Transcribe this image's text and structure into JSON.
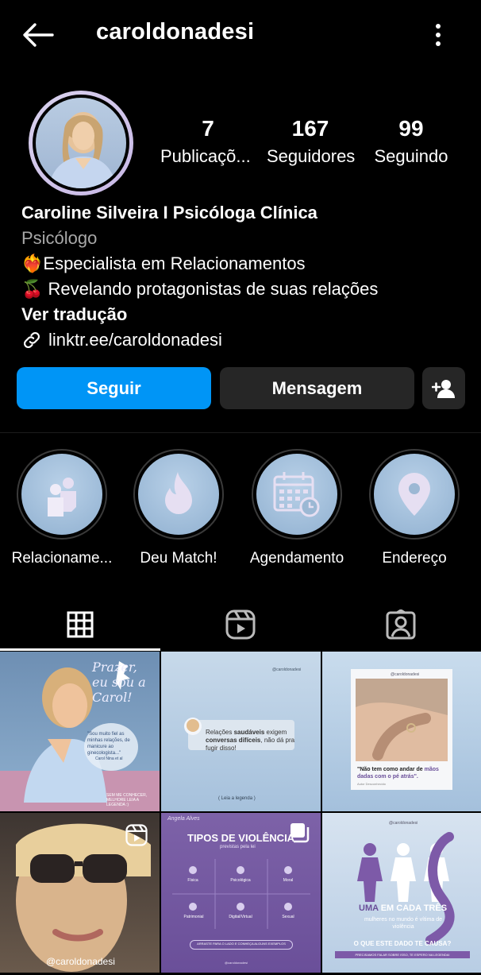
{
  "header": {
    "username": "caroldonadesi",
    "back_icon": "arrow-left-icon",
    "menu_icon": "more-vertical-icon"
  },
  "stats": [
    {
      "value": "7",
      "label": "Publicaçõ..."
    },
    {
      "value": "167",
      "label": "Seguidores"
    },
    {
      "value": "99",
      "label": "Seguindo"
    }
  ],
  "bio": {
    "name": "Caroline Silveira I Psicóloga Clínica",
    "category": "Psicólogo",
    "line1": "❤️‍🔥Especialista em Relacionamentos",
    "line2": "🍒 Revelando protagonistas de suas relações",
    "translate": "Ver tradução",
    "link": "linktr.ee/caroldonadesi"
  },
  "buttons": {
    "follow": "Seguir",
    "message": "Mensagem"
  },
  "highlights": [
    {
      "label": "Relacioname...",
      "icon": "people-icon"
    },
    {
      "label": "Deu Match!",
      "icon": "flame-icon"
    },
    {
      "label": "Agendamento",
      "icon": "calendar-icon"
    },
    {
      "label": "Endereço",
      "icon": "location-pin-icon"
    }
  ],
  "tabs": [
    {
      "name": "grid",
      "icon": "grid-icon",
      "active": true
    },
    {
      "name": "reels",
      "icon": "reels-icon",
      "active": false
    },
    {
      "name": "tagged",
      "icon": "tagged-icon",
      "active": false
    }
  ],
  "posts": {
    "p1": {
      "title": "Prazer, eu sou a Carol!",
      "quote": "\"Sou muito fiel as minhas relações, de manicure ao ginecologista...\"",
      "author": "Carol Nina et al",
      "cta": "SEM ME CONHECER, MELHORE LEIA A LEGENDA :)"
    },
    "p2": {
      "text_a": "Relações ",
      "text_b": "saudáveis",
      "text_c": " exigem ",
      "text_d": "conversas difíceis",
      "text_e": ", não dá pra fugir disso!",
      "handle": "@caroldonadesi",
      "cta": "( Leia a legenda )"
    },
    "p3": {
      "handle": "@caroldonadesi",
      "quote_a": "\"Não tem como andar de ",
      "quote_b": "mãos dadas com o pé atrás\".",
      "author": "Autor Desconhecido"
    },
    "p4": {
      "handle": "@caroldonadesi"
    },
    "p5": {
      "script": "Angela Alves",
      "title": "TIPOS DE VIOLÊNCIA",
      "subtitle": "previstas pela lei",
      "types": [
        "Física",
        "Psicológica",
        "Moral",
        "Patrimonial",
        "Digital/Virtual",
        "Sexual"
      ],
      "cta": "ARRASTE PARA O LADO E CONHEÇA ALGUNS EXEMPLOS",
      "handle": "@caroldonadesi"
    },
    "p6": {
      "handle": "@caroldonadesi",
      "headline_a": "UMA",
      "headline_b": " EM CADA TRÊS",
      "sub": "mulheres no mundo é vítima de violência",
      "question": "O QUE ESTE DADO TE CAUSA?",
      "cta": "PRECISAMOS FALAR SOBRE ISSO, TE ESPERO NA LEGENDA!"
    }
  },
  "colors": {
    "primary_button": "#0095f6",
    "secondary_button": "#262626",
    "background": "#000000",
    "muted_text": "#a8a8a8"
  }
}
